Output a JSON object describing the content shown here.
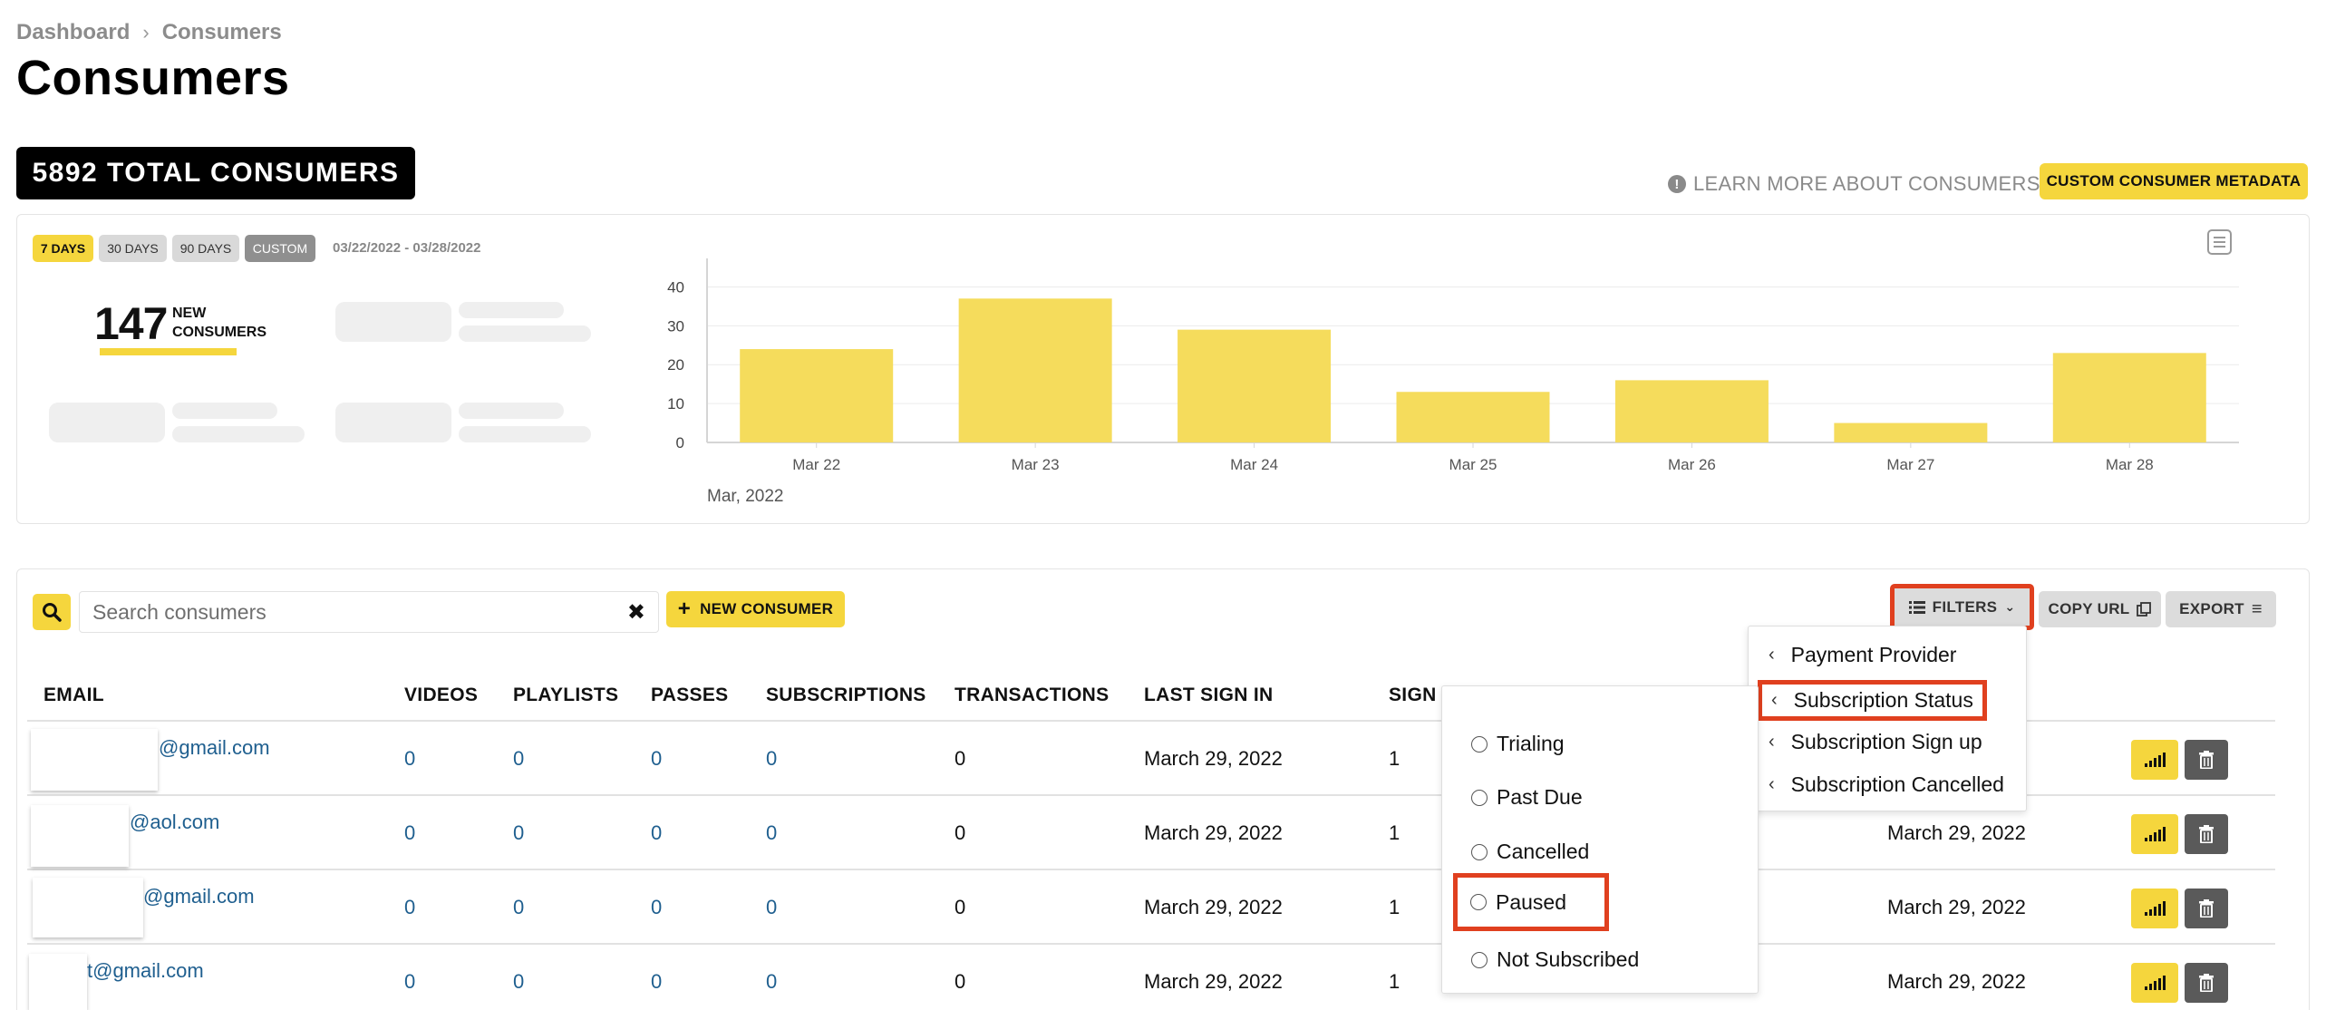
{
  "breadcrumb": {
    "items": [
      "Dashboard",
      "Consumers"
    ],
    "separator": "›"
  },
  "page_title": "Consumers",
  "total_badge": "5892 TOTAL CONSUMERS",
  "learn_more": "LEARN MORE ABOUT CONSUMERS",
  "custom_metadata_button": "CUSTOM CONSUMER METADATA",
  "stats": {
    "ranges": [
      {
        "label": "7 DAYS",
        "state": "active"
      },
      {
        "label": "30 DAYS",
        "state": "normal"
      },
      {
        "label": "90 DAYS",
        "state": "normal"
      },
      {
        "label": "CUSTOM",
        "state": "custom"
      }
    ],
    "date_range": "03/22/2022 - 03/28/2022",
    "new_count": "147",
    "new_label_line1": "NEW",
    "new_label_line2": "CONSUMERS"
  },
  "chart_data": {
    "type": "bar",
    "categories": [
      "Mar 22",
      "Mar 23",
      "Mar 24",
      "Mar 25",
      "Mar 26",
      "Mar 27",
      "Mar 28"
    ],
    "values": [
      24,
      37,
      29,
      13,
      16,
      5,
      23
    ],
    "yticks": [
      0,
      10,
      20,
      30,
      40
    ],
    "ylim": [
      0,
      45
    ],
    "xlabel": "Mar, 2022",
    "bar_color": "#f5dc5c"
  },
  "toolbar": {
    "search_placeholder": "Search consumers",
    "clear_glyph": "✖",
    "new_consumer": "NEW CONSUMER",
    "filters": "FILTERS",
    "copy_url": "COPY URL",
    "export": "EXPORT"
  },
  "table": {
    "headers": [
      "EMAIL",
      "VIDEOS",
      "PLAYLISTS",
      "PASSES",
      "SUBSCRIPTIONS",
      "TRANSACTIONS",
      "LAST SIGN IN",
      "SIGN"
    ],
    "rows": [
      {
        "email": "@gmail.com",
        "videos": "0",
        "playlists": "0",
        "passes": "0",
        "subscriptions": "0",
        "transactions": "0",
        "last_sign_in": "March 29, 2022",
        "sign_count": "1",
        "created": ""
      },
      {
        "email": "@aol.com",
        "videos": "0",
        "playlists": "0",
        "passes": "0",
        "subscriptions": "0",
        "transactions": "0",
        "last_sign_in": "March 29, 2022",
        "sign_count": "1",
        "created": "March 29, 2022"
      },
      {
        "email": "@gmail.com",
        "videos": "0",
        "playlists": "0",
        "passes": "0",
        "subscriptions": "0",
        "transactions": "0",
        "last_sign_in": "March 29, 2022",
        "sign_count": "1",
        "created": "March 29, 2022"
      },
      {
        "email": "t@gmail.com",
        "videos": "0",
        "playlists": "0",
        "passes": "0",
        "subscriptions": "0",
        "transactions": "0",
        "last_sign_in": "March 29, 2022",
        "sign_count": "1",
        "created": "March 29, 2022"
      }
    ]
  },
  "filter_menu": {
    "items": [
      "Payment Provider",
      "Subscription Status",
      "Subscription Sign up",
      "Subscription Cancelled"
    ],
    "highlighted": "Subscription Status"
  },
  "status_menu": {
    "options": [
      "Trialing",
      "Past Due",
      "Cancelled",
      "Paused",
      "Not Subscribed"
    ],
    "highlighted": "Paused"
  },
  "colors": {
    "accent": "#f5d63d",
    "highlight_box": "#e0401f",
    "link": "#1f5f8f",
    "dark_button": "#5a5a5a"
  }
}
